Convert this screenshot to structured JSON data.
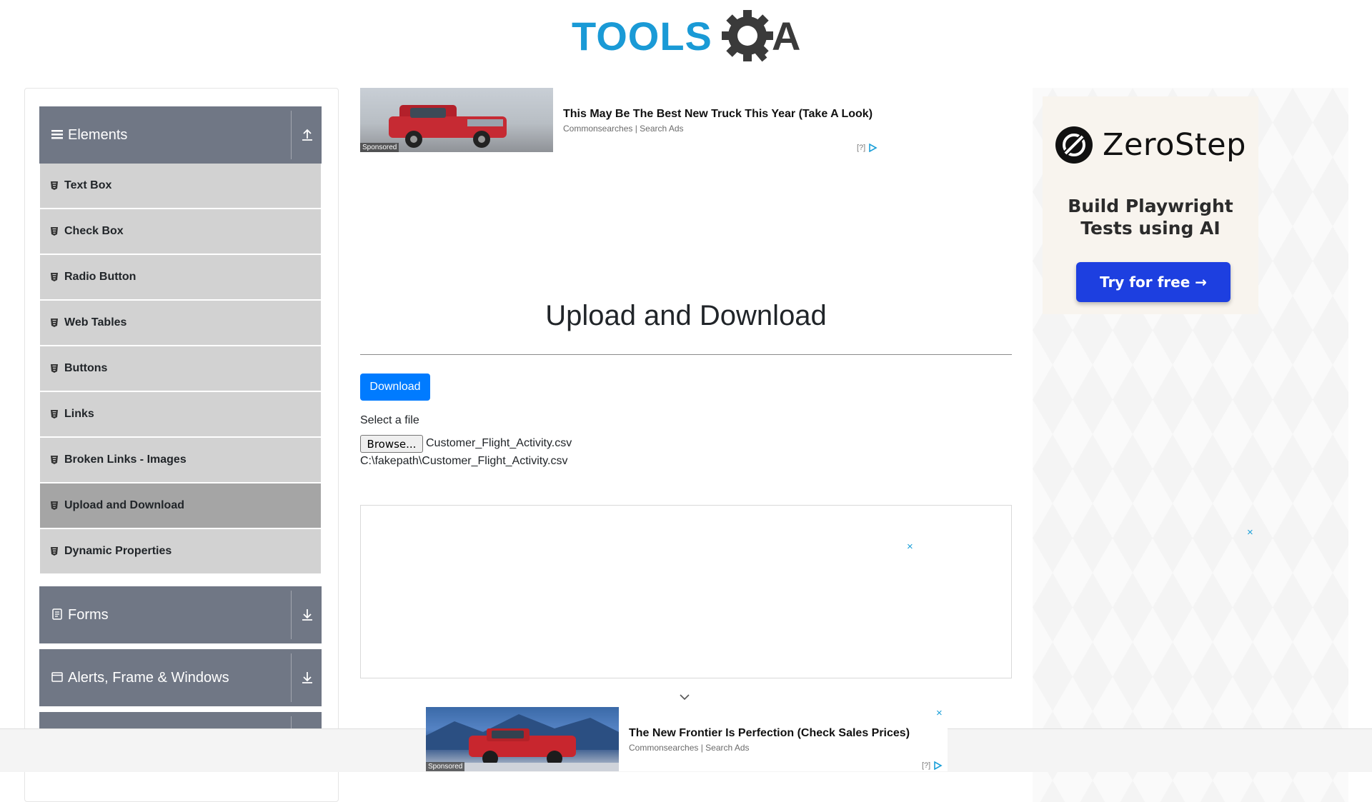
{
  "logo": {
    "text": "TOOLSQA"
  },
  "sidebar": {
    "groups": [
      {
        "title": "Elements",
        "expanded": true
      },
      {
        "title": "Forms",
        "expanded": false
      },
      {
        "title": "Alerts, Frame & Windows",
        "expanded": false
      }
    ],
    "elements_items": [
      {
        "label": "Text Box",
        "active": false
      },
      {
        "label": "Check Box",
        "active": false
      },
      {
        "label": "Radio Button",
        "active": false
      },
      {
        "label": "Web Tables",
        "active": false
      },
      {
        "label": "Buttons",
        "active": false
      },
      {
        "label": "Links",
        "active": false
      },
      {
        "label": "Broken Links - Images",
        "active": false
      },
      {
        "label": "Upload and Download",
        "active": true
      },
      {
        "label": "Dynamic Properties",
        "active": false
      }
    ]
  },
  "ad_top": {
    "headline": "This May Be The Best New Truck This Year (Take A Look)",
    "source": "Commonsearches | Search Ads",
    "sponsored": "Sponsored",
    "choices": "[?]"
  },
  "main": {
    "title": "Upload and Download",
    "download_label": "Download",
    "select_label": "Select a file",
    "browse_label": "Browse...",
    "file_name": "Customer_Flight_Activity.csv",
    "file_path": "C:\\fakepath\\Customer_Flight_Activity.csv"
  },
  "ad_close": "×",
  "right_ad": {
    "brand": "ZeroStep",
    "tagline_line1": "Build Playwright",
    "tagline_line2": "Tests using AI",
    "cta": "Try for free →"
  },
  "ad_bottom": {
    "headline": "The New Frontier Is Perfection (Check Sales Prices)",
    "source": "Commonsearches | Search Ads",
    "sponsored": "Sponsored",
    "choices": "[?]"
  },
  "colors": {
    "accent": "#007bff",
    "header_bg": "#707785",
    "item_bg": "#d2d2d2",
    "item_active_bg": "#a5a5a5",
    "cta": "#1d3fe0"
  }
}
